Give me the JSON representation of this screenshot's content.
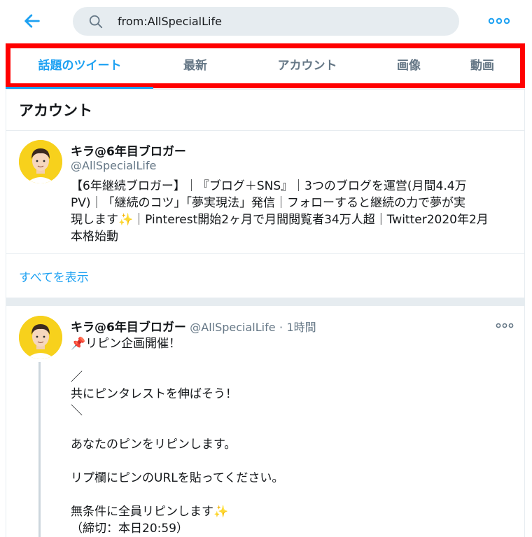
{
  "search": {
    "query": "from:AllSpecialLife"
  },
  "tabs": [
    {
      "label": "話題のツイート",
      "active": true
    },
    {
      "label": "最新"
    },
    {
      "label": "アカウント"
    },
    {
      "label": "画像"
    },
    {
      "label": "動画"
    }
  ],
  "accounts": {
    "title": "アカウント",
    "user": {
      "name": "キラ@6年目ブロガー",
      "handle": "@AllSpecialLife",
      "bio_lines": [
        "【6年継続ブロガー】｜『ブログ＋SNS』｜3つのブログを運営(月間4.4万",
        "PV)｜「継続のコツ」「夢実現法」発信｜フォローすると継続の力で夢が実",
        "現します",
        "｜Pinterest開始2ヶ月で月間閲覧者34万人超｜Twitter2020年2月",
        "本格始動"
      ],
      "sparkle": "✨"
    },
    "show_all": "すべてを表示"
  },
  "tweet": {
    "name": "キラ@6年目ブロガー",
    "handle": "@AllSpecialLife",
    "separator": "·",
    "time": "1時間",
    "pin_emoji": "📌",
    "lines": {
      "l1": "リピン企画開催！",
      "l2": "／",
      "l3": "共にピンタレストを伸ばそう！",
      "l4": "＼",
      "l5": "あなたのピンをリピンします。",
      "l6": "リプ欄にピンのURLを貼ってください。",
      "l7": "無条件に全員リピンします",
      "l8": "（締切：本日20:59）"
    }
  },
  "colors": {
    "accent": "#1da1f2",
    "highlight_frame": "#ff0000",
    "avatar_bg": "#f7d11c"
  },
  "icons": [
    "back-arrow-icon",
    "search-icon",
    "more-icon"
  ]
}
